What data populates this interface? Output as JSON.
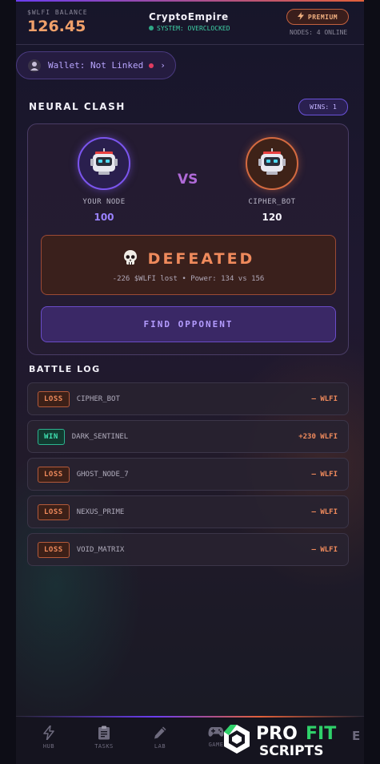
{
  "header": {
    "balance_label": "$WLFI BALANCE",
    "balance_value": "126.45",
    "app_name": "CryptoEmpire",
    "system_status": "SYSTEM: OVERCLOCKED",
    "premium_label": "PREMIUM",
    "nodes_online": "NODES: 4 ONLINE"
  },
  "wallet": {
    "label": "Wallet: Not Linked",
    "chevron": "›"
  },
  "battle": {
    "section_title": "NEURAL CLASH",
    "wins_label": "WINS: 1",
    "player": {
      "name": "YOUR NODE",
      "power": "100",
      "icon": "robot-icon"
    },
    "vs": "VS",
    "opponent": {
      "name": "CIPHER_BOT",
      "power": "120",
      "icon": "robot-icon"
    },
    "result": {
      "icon": "skull-icon",
      "title": "DEFEATED",
      "detail": "-226 $WLFI lost • Power: 134 vs 156"
    },
    "find_button": "FIND OPPONENT"
  },
  "battle_log": {
    "title": "BATTLE LOG",
    "entries": [
      {
        "result": "LOSS",
        "opponent": "CIPHER_BOT",
        "delta": "— WLFI"
      },
      {
        "result": "WIN",
        "opponent": "DARK_SENTINEL",
        "delta": "+230 WLFI"
      },
      {
        "result": "LOSS",
        "opponent": "GHOST_NODE_7",
        "delta": "— WLFI"
      },
      {
        "result": "LOSS",
        "opponent": "NEXUS_PRIME",
        "delta": "— WLFI"
      },
      {
        "result": "LOSS",
        "opponent": "VOID_MATRIX",
        "delta": "— WLFI"
      }
    ]
  },
  "nav": {
    "items": [
      {
        "label": "HUB",
        "icon": "lightning-icon"
      },
      {
        "label": "TASKS",
        "icon": "clipboard-icon"
      },
      {
        "label": "LAB",
        "icon": "pen-icon"
      },
      {
        "label": "GAME",
        "icon": "gamepad-icon"
      }
    ],
    "partial_label": "E"
  },
  "watermark": {
    "line1a": "PRO",
    "line1b": "FIT",
    "line2": "SCRIPTS"
  },
  "colors": {
    "accent_purple": "#6b3df0",
    "accent_orange": "#e2603a",
    "loss": "#ef8a5c",
    "win": "#3fe0b0",
    "online": "#3fd1a6"
  }
}
